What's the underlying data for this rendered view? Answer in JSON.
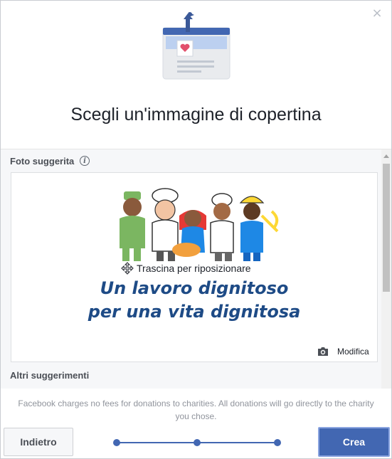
{
  "dialog": {
    "title": "Scegli un'immagine di copertina",
    "close_label": "×"
  },
  "suggested": {
    "label": "Foto suggerita",
    "info_glyph": "i",
    "drag_hint": "Trascina per riposizionare",
    "slogan_line1": "Un lavoro dignitoso",
    "slogan_line2": "per una vita dignitosa",
    "edit_label": "Modifica"
  },
  "more": {
    "label": "Altri suggerimenti"
  },
  "footer": {
    "note": "Facebook charges no fees for donations to charities. All donations will go directly to the charity you chose.",
    "back_label": "Indietro",
    "create_label": "Crea",
    "steps_total": 3,
    "step_current": 3
  },
  "colors": {
    "accent": "#4267b2",
    "slogan": "#1e4b86",
    "muted_text": "#90949c"
  },
  "icons": {
    "close": "close-icon",
    "info": "info-icon",
    "move": "move-icon",
    "camera": "camera-icon"
  }
}
